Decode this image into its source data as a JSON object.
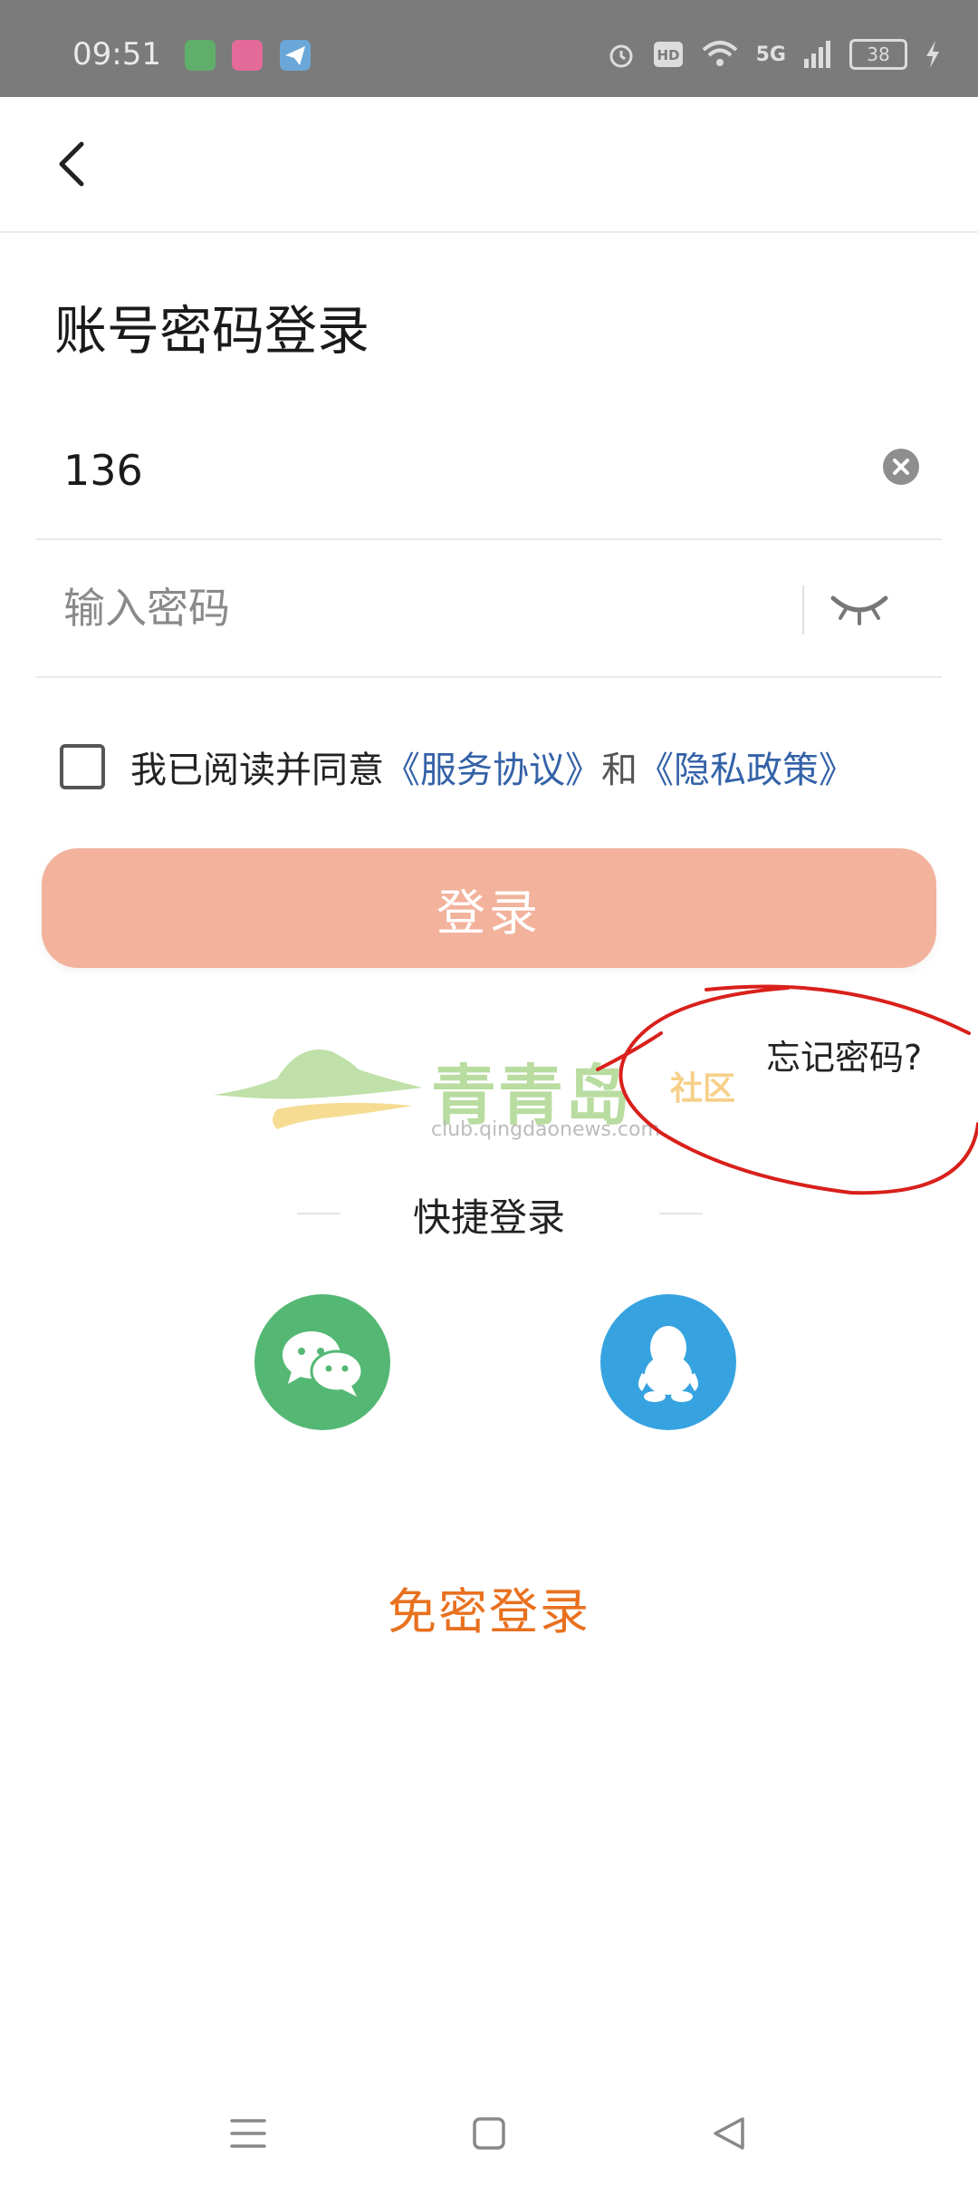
{
  "status_bar": {
    "time": "09:51",
    "network": "5G",
    "battery": "38",
    "icons": [
      "message-app-icon",
      "pink-app-icon",
      "paper-plane-app-icon",
      "alarm-icon",
      "hd-icon",
      "wifi-icon",
      "signal-icon",
      "charging-icon"
    ]
  },
  "header": {
    "back_icon": "chevron-left-icon"
  },
  "page": {
    "title": "账号密码登录"
  },
  "form": {
    "phone_value": "136",
    "password_value": "",
    "password_placeholder": "输入密码"
  },
  "agreement": {
    "prefix": "我已阅读并同意",
    "service_link": "《服务协议》",
    "and": "和",
    "privacy_link": "《隐私政策》",
    "checked": false
  },
  "login_button": "登录",
  "watermark": {
    "name": "青青岛",
    "club": "社区",
    "url": "club.qingdaonews.com"
  },
  "forgot_password": "忘记密码?",
  "quick_login": {
    "label": "快捷登录",
    "options": [
      {
        "name": "wechat",
        "icon": "wechat-icon",
        "color": "#54b874"
      },
      {
        "name": "qq",
        "icon": "qq-penguin-icon",
        "color": "#36a3e0"
      }
    ]
  },
  "no_password_login": "免密登录",
  "colors": {
    "status_bar_bg": "#7b7b7b",
    "login_button_bg": "#f2b29c",
    "link": "#3462a8",
    "accent_orange": "#e8711f",
    "annotation_red": "#d9201b"
  },
  "nav_bar": {
    "icons": [
      "menu-icon",
      "home-icon",
      "back-triangle-icon"
    ]
  }
}
